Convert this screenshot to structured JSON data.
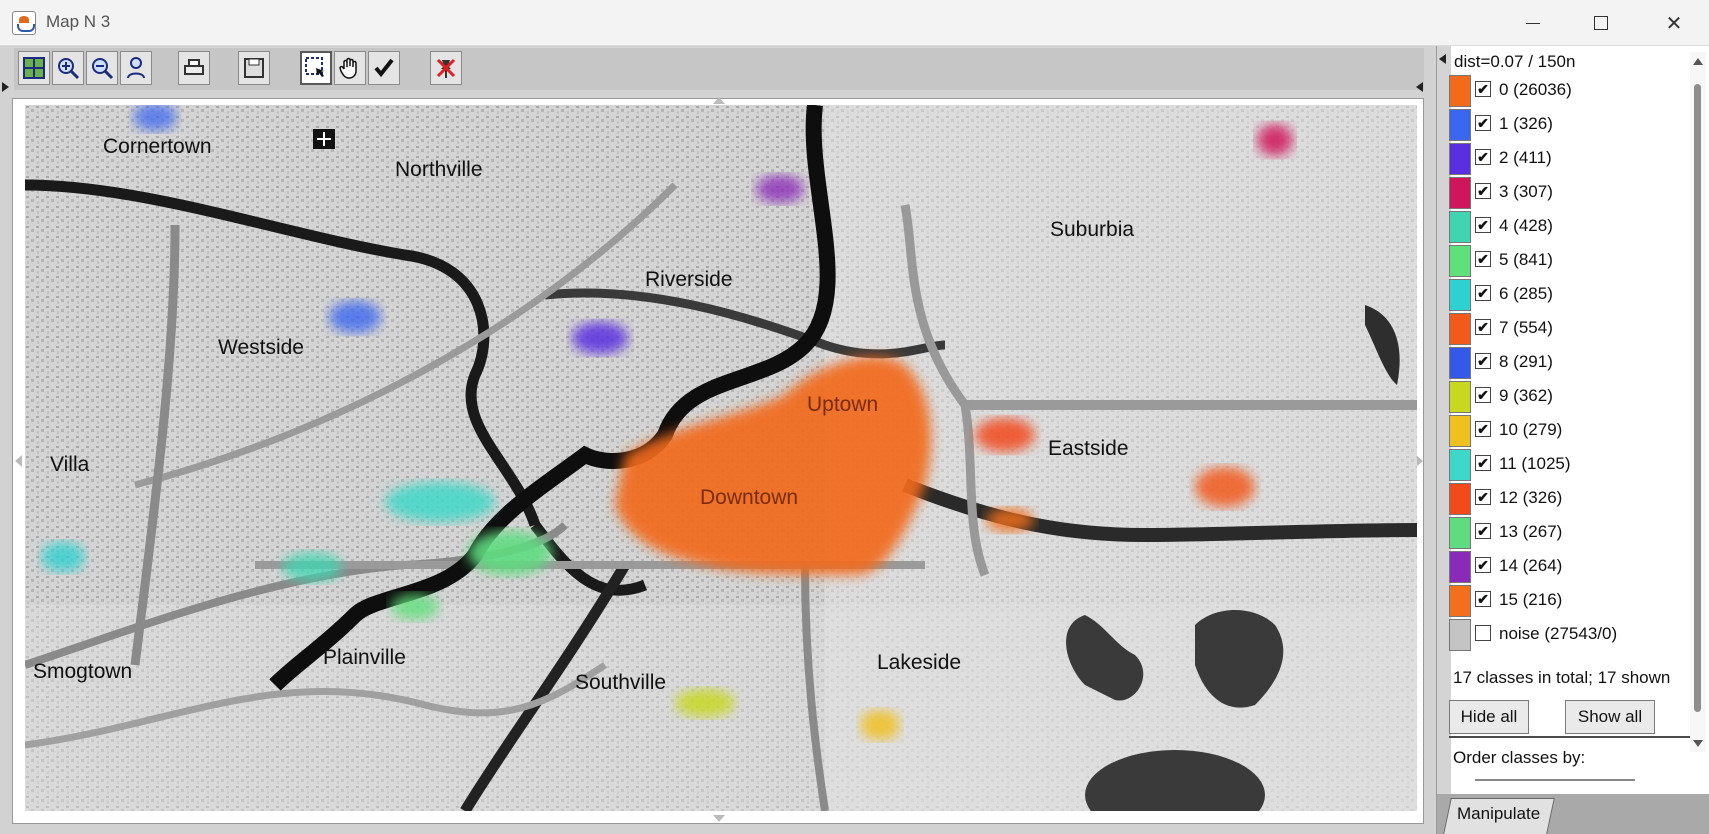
{
  "window": {
    "title": "Map N 3"
  },
  "toolbar": {
    "buttons": [
      {
        "name": "fit-map-button",
        "icon": "fit-map-icon"
      },
      {
        "name": "zoom-in-button",
        "icon": "zoom-in-icon"
      },
      {
        "name": "zoom-out-button",
        "icon": "zoom-out-icon"
      },
      {
        "name": "zoom-to-selection-button",
        "icon": "zoom-person-icon"
      },
      {
        "name": "print-button",
        "icon": "printer-icon"
      },
      {
        "name": "save-button",
        "icon": "floppy-icon"
      },
      {
        "name": "select-tool-button",
        "icon": "selection-cursor-icon"
      },
      {
        "name": "pan-tool-button",
        "icon": "hand-icon"
      },
      {
        "name": "confirm-button",
        "icon": "check-icon"
      },
      {
        "name": "clear-selection-button",
        "icon": "pin-cross-icon"
      }
    ]
  },
  "map": {
    "places": [
      "Cornertown",
      "Northville",
      "Suburbia",
      "Riverside",
      "Westside",
      "Uptown",
      "Eastside",
      "Villa",
      "Downtown",
      "Smogtown",
      "Plainville",
      "Southville",
      "Lakeside"
    ]
  },
  "legend": {
    "header": "dist=0.07 / 150n",
    "items": [
      {
        "label": "0 (26036)",
        "color": "#f26a1b",
        "checked": "✔"
      },
      {
        "label": "1 (326)",
        "color": "#3b66f0",
        "checked": "✔"
      },
      {
        "label": "2 (411)",
        "color": "#5a2fe0",
        "checked": "✔"
      },
      {
        "label": "3 (307)",
        "color": "#d0165a",
        "checked": "✔"
      },
      {
        "label": "4 (428)",
        "color": "#3fd5b0",
        "checked": "✔"
      },
      {
        "label": "5 (841)",
        "color": "#5fe07a",
        "checked": "✔"
      },
      {
        "label": "6 (285)",
        "color": "#2fd0d0",
        "checked": "✔"
      },
      {
        "label": "7 (554)",
        "color": "#f25a1b",
        "checked": "✔"
      },
      {
        "label": "8 (291)",
        "color": "#3458e8",
        "checked": "✔"
      },
      {
        "label": "9 (362)",
        "color": "#c8d820",
        "checked": "✔"
      },
      {
        "label": "10 (279)",
        "color": "#f0c020",
        "checked": "✔"
      },
      {
        "label": "11 (1025)",
        "color": "#3fd8c8",
        "checked": "✔"
      },
      {
        "label": "12 (326)",
        "color": "#f24a1b",
        "checked": "✔"
      },
      {
        "label": "13 (267)",
        "color": "#5fdc80",
        "checked": "✔"
      },
      {
        "label": "14 (264)",
        "color": "#8a2ab8",
        "checked": "✔"
      },
      {
        "label": "15 (216)",
        "color": "#f2701b",
        "checked": "✔"
      },
      {
        "label": "noise (27543/0)",
        "color": "#c4c4c4",
        "checked": ""
      }
    ],
    "summary": "17 classes in total; 17 shown",
    "hide_all": "Hide all",
    "show_all": "Show all",
    "order_label": "Order classes by:"
  },
  "tabs": {
    "manipulate": "Manipulate"
  }
}
